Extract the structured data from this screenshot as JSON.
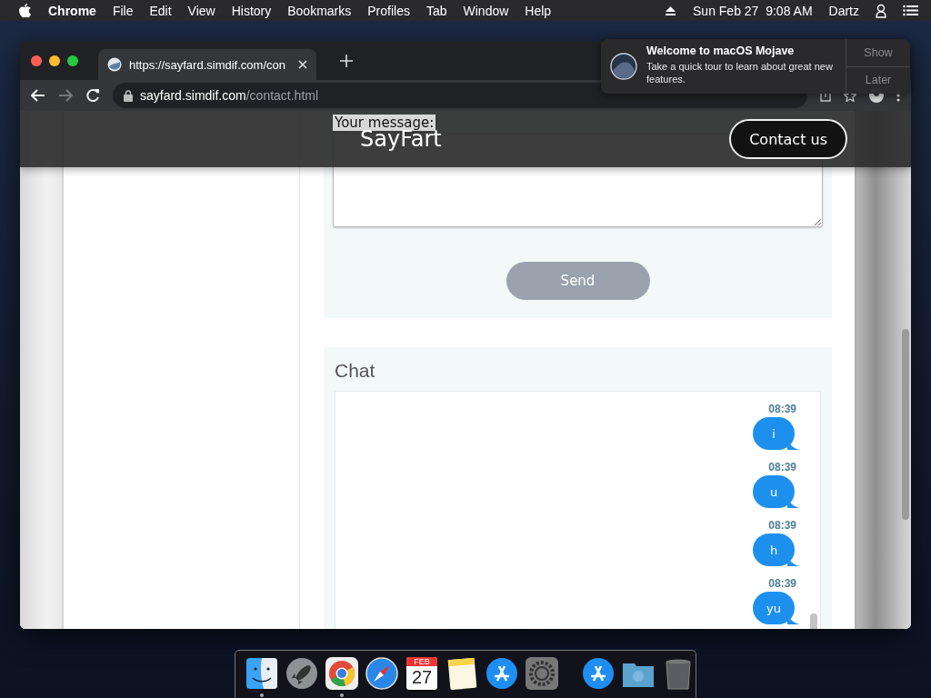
{
  "menu_bar": {
    "app_name": "Chrome",
    "items": [
      "File",
      "Edit",
      "View",
      "History",
      "Bookmarks",
      "Profiles",
      "Tab",
      "Window",
      "Help"
    ],
    "clock": "Sun Feb 27  9:08 AM",
    "user": "Dartz"
  },
  "browser": {
    "tab": {
      "title": "https://sayfard.simdif.com/con",
      "selected": true
    },
    "address": {
      "host": "sayfard.simdif.com",
      "path": "/contact.html"
    },
    "forward_disabled": true
  },
  "site": {
    "brand": "SayFart",
    "contact_button": "Contact us",
    "message_label": "Your message:",
    "send_button": {
      "label": "Send",
      "disabled": true
    },
    "chat": {
      "title": "Chat",
      "messages": [
        {
          "time": "08:39",
          "text": "i"
        },
        {
          "time": "08:39",
          "text": "u"
        },
        {
          "time": "08:39",
          "text": "h"
        },
        {
          "time": "08:39",
          "text": "yu"
        }
      ]
    }
  },
  "notification": {
    "title": "Welcome to macOS Mojave",
    "body": "Take a quick tour to learn about great new features.",
    "actions": [
      "Show",
      "Later"
    ]
  },
  "dock": [
    {
      "kind": "finder",
      "running": true
    },
    {
      "kind": "launchpad",
      "running": false
    },
    {
      "kind": "chrome",
      "running": true
    },
    {
      "kind": "safari",
      "running": false
    },
    {
      "kind": "calendar",
      "running": false,
      "month": "FEB",
      "day": "27"
    },
    {
      "kind": "notes",
      "running": false
    },
    {
      "kind": "appstore",
      "running": false
    },
    {
      "kind": "settings",
      "running": false
    },
    {
      "kind": "separator"
    },
    {
      "kind": "appstore",
      "running": false
    },
    {
      "kind": "folder",
      "running": false
    },
    {
      "kind": "trash",
      "running": false
    }
  ]
}
